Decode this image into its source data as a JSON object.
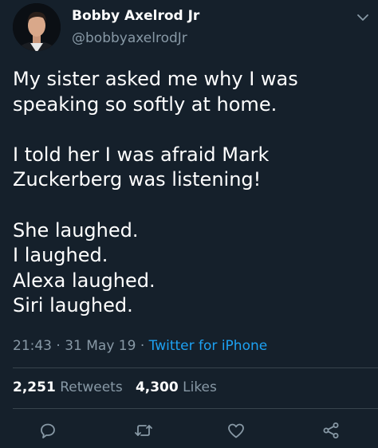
{
  "author": {
    "display_name": "Bobby Axelrod Jr",
    "handle": "@bobbyaxelrodJr"
  },
  "tweet": {
    "lines": [
      "My sister asked me why I was",
      "speaking so softly at home.",
      "",
      "I told her I was afraid Mark",
      "Zuckerberg was listening!",
      "",
      "She laughed.",
      "I laughed.",
      "Alexa laughed.",
      "Siri laughed."
    ]
  },
  "meta": {
    "time": "21:43",
    "date": "31 May 19",
    "separator": "·",
    "source": "Twitter for iPhone"
  },
  "stats": {
    "retweets_count": "2,251",
    "retweets_label": "Retweets",
    "likes_count": "4,300",
    "likes_label": "Likes"
  },
  "icons": {
    "reply": "reply-icon",
    "retweet": "retweet-icon",
    "like": "heart-icon",
    "share": "share-icon",
    "caret": "chevron-down-icon"
  },
  "colors": {
    "background": "#15202b",
    "text_primary": "#ffffff",
    "text_secondary": "#8899a6",
    "link": "#1da1f2",
    "divider": "#38444d"
  }
}
